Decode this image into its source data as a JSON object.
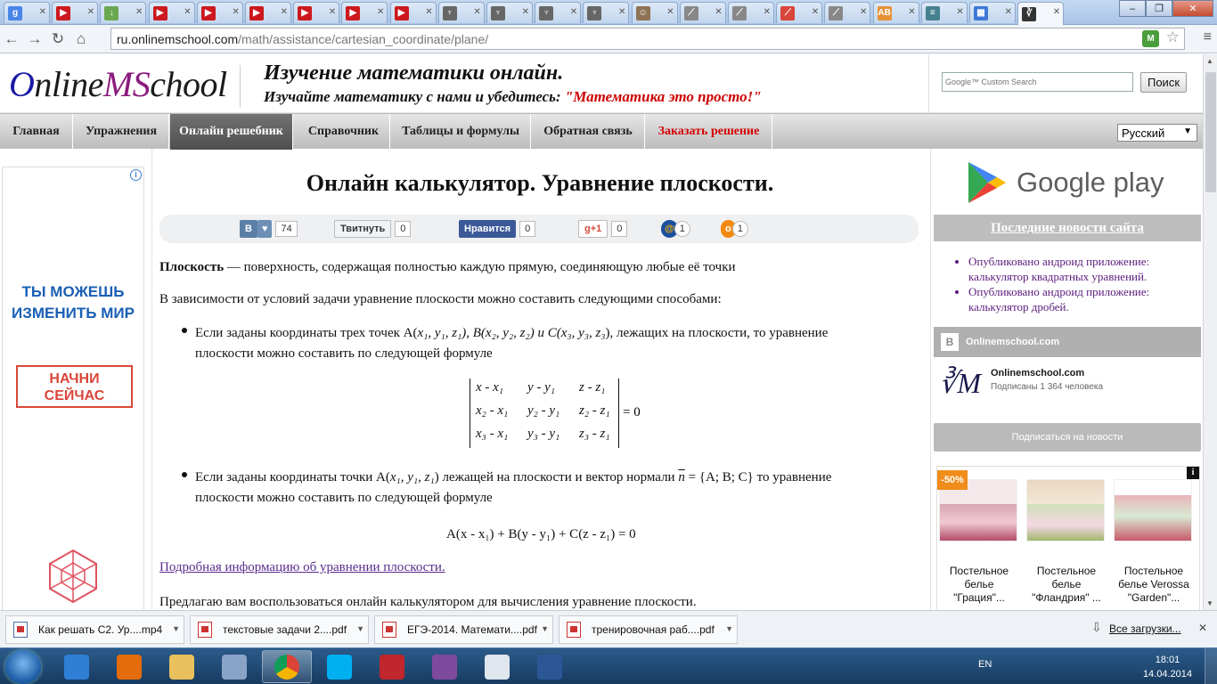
{
  "browser": {
    "tabs": [
      {
        "icon": "google-plus-icon",
        "color": "#4a86e8",
        "glyph": "g"
      },
      {
        "icon": "youtube-icon",
        "color": "#cc181e",
        "glyph": "▶"
      },
      {
        "icon": "download-icon",
        "color": "#6aa84f",
        "glyph": "↓"
      },
      {
        "icon": "youtube-icon",
        "color": "#cc181e",
        "glyph": "▶"
      },
      {
        "icon": "youtube-icon",
        "color": "#cc181e",
        "glyph": "▶"
      },
      {
        "icon": "youtube-icon",
        "color": "#cc181e",
        "glyph": "▶"
      },
      {
        "icon": "youtube-icon",
        "color": "#cc181e",
        "glyph": "▶"
      },
      {
        "icon": "youtube-icon",
        "color": "#cc181e",
        "glyph": "▶"
      },
      {
        "icon": "youtube-icon",
        "color": "#cc181e",
        "glyph": "▶"
      },
      {
        "icon": "emblem-icon",
        "color": "#666666",
        "glyph": "♆"
      },
      {
        "icon": "emblem-icon",
        "color": "#666666",
        "glyph": "♆"
      },
      {
        "icon": "emblem-icon",
        "color": "#666666",
        "glyph": "♆"
      },
      {
        "icon": "emblem-icon",
        "color": "#666666",
        "glyph": "♆"
      },
      {
        "icon": "avatar-icon",
        "color": "#8e7355",
        "glyph": "☺"
      },
      {
        "icon": "doc-icon",
        "color": "#888888",
        "glyph": "⟋"
      },
      {
        "icon": "doc-icon",
        "color": "#888888",
        "glyph": "⟋"
      },
      {
        "icon": "doc-icon",
        "color": "#d9463a",
        "glyph": "⟋"
      },
      {
        "icon": "doc-icon",
        "color": "#888888",
        "glyph": "⟋"
      },
      {
        "icon": "ab-icon",
        "color": "#e69138",
        "glyph": "AB"
      },
      {
        "icon": "bars-icon",
        "color": "#45818e",
        "glyph": "≡"
      },
      {
        "icon": "windows-icon",
        "color": "#3c78d8",
        "glyph": "▦"
      },
      {
        "icon": "onlinemschool-icon",
        "color": "#333333",
        "glyph": "∛",
        "active": true
      }
    ],
    "window_controls": {
      "minimize": "–",
      "maximize": "❐",
      "close": "✕"
    },
    "url_host": "ru.onlinemschool.com",
    "url_path": "/math/assistance/cartesian_coordinate/plane/",
    "nav": {
      "back": "←",
      "forward": "→",
      "reload": "↻",
      "home": "⌂"
    },
    "star": "☆",
    "menu": "≡",
    "ext_badge": "M"
  },
  "site": {
    "logo": {
      "o": "O",
      "nline": "nline",
      "ms": "MS",
      "chool": "chool"
    },
    "slogan_title": "Изучение математики онлайн.",
    "slogan_sub": "Изучайте математику с нами и убедитесь: ",
    "slogan_quote": "\"Математика это просто!\"",
    "search_placeholder": "Google™ Custom Search",
    "search_button": "Поиск",
    "nav": [
      {
        "label": "Главная"
      },
      {
        "label": "Упражнения"
      },
      {
        "label": "Онлайн решебник",
        "active": true
      },
      {
        "label": "Справочник"
      },
      {
        "label": "Таблицы и формулы"
      },
      {
        "label": "Обратная связь"
      },
      {
        "label": "Заказать решение",
        "red": true
      }
    ],
    "language": "Русский"
  },
  "left_ad": {
    "line1": "ТЫ МОЖЕШЬ",
    "line2": "ИЗМЕНИТЬ МИР",
    "cta1": "НАЧНИ",
    "cta2": "СЕЙЧАС",
    "info": "i"
  },
  "content": {
    "title": "Онлайн калькулятор. Уравнение плоскости.",
    "share": {
      "vk_label": "В",
      "vk_count": "74",
      "tw_label": "Твитнуть",
      "tw_count": "0",
      "fb_label": "Нравится",
      "fb_count": "0",
      "gp_label": "g+1",
      "gp_count": "0",
      "mail_count": "1",
      "ok_count": "1"
    },
    "def_term": "Плоскость",
    "def_text": " — поверхность, содержащая полностью каждую прямую, соединяющую любые её точки",
    "intro": "В зависимости от условий задачи уравнение плоскости можно составить следующими способами:",
    "bullet1_a": "Если заданы координаты трех точек A(",
    "bullet1_b": "), лежащих на плоскости, то уравнение",
    "bullet1_line2": "плоскости можно составить по следующей формуле",
    "points": "x₁, y₁, z₁), B(x₂, y₂, z₂) и C(x₃, y₃, z₃",
    "det_rows": [
      [
        "x - x₁",
        "y - y₁",
        "z - z₁"
      ],
      [
        "x₂ - x₁",
        "y₂ - y₁",
        "z₂ - z₁"
      ],
      [
        "x₃ - x₁",
        "y₃ - y₁",
        "z₃ - z₁"
      ]
    ],
    "det_rhs": "= 0",
    "bullet2_a": "Если заданы координаты точки A(",
    "bullet2_pt": "x₁, y₁, z₁",
    "bullet2_b": ") лежащей на плоскости и вектор нормали ",
    "normal": "n",
    "bullet2_c": " = {A; B; C} то уравнение",
    "bullet2_line2": "плоскости можно составить по следующей формуле",
    "formula2": "A(x - x₁) + B(y - y₁) + C(z - z₁) = 0",
    "more_link": "Подробная информацию об уравнении плоскости.",
    "offer": "Предлагаю вам воспользоваться онлайн калькулятором для вычисления уравнение плоскости."
  },
  "right": {
    "gplay": "Google play",
    "news_title": "Последние новости сайта",
    "news": [
      "Опубликовано андроид приложение: калькулятор квадратных уравнений.",
      "Опубликовано андроид приложение: калькулятор дробей."
    ],
    "vk_group": "Onlinemschool.com",
    "vk_card_name": "Onlinemschool.com",
    "vk_subs": "Подписаны 1 364 человека",
    "vk_button": "Подписаться на новости",
    "sale": "-50%",
    "products": [
      "Постельное белье \"Грация\"...",
      "Постельное белье \"Фландрия\" ...",
      "Постельное белье Verossa \"Garden\"..."
    ]
  },
  "downloads": {
    "items": [
      "Как решать С2. Ур....mp4",
      "текстовые задачи 2....pdf",
      "ЕГЭ-2014. Математи....pdf",
      "тренировочная раб....pdf"
    ],
    "all": "Все загрузки...",
    "close": "✕"
  },
  "taskbar": {
    "lang": "EN",
    "time": "18:01",
    "date": "14.04.2014",
    "apps": [
      {
        "name": "ie-icon",
        "color": "#2f7fd6"
      },
      {
        "name": "media-player-icon",
        "color": "#e46c0a"
      },
      {
        "name": "explorer-icon",
        "color": "#e9c15c"
      },
      {
        "name": "paint-icon",
        "color": "#8aa4c8"
      },
      {
        "name": "chrome-icon",
        "color": "#3b9a3b",
        "active": true
      },
      {
        "name": "skype-icon",
        "color": "#00aff0"
      },
      {
        "name": "acrobat-icon",
        "color": "#c0262b"
      },
      {
        "name": "winrar-icon",
        "color": "#7e4a9e"
      },
      {
        "name": "notepad-icon",
        "color": "#dfe6ee"
      },
      {
        "name": "word-icon",
        "color": "#2b5797"
      }
    ]
  }
}
